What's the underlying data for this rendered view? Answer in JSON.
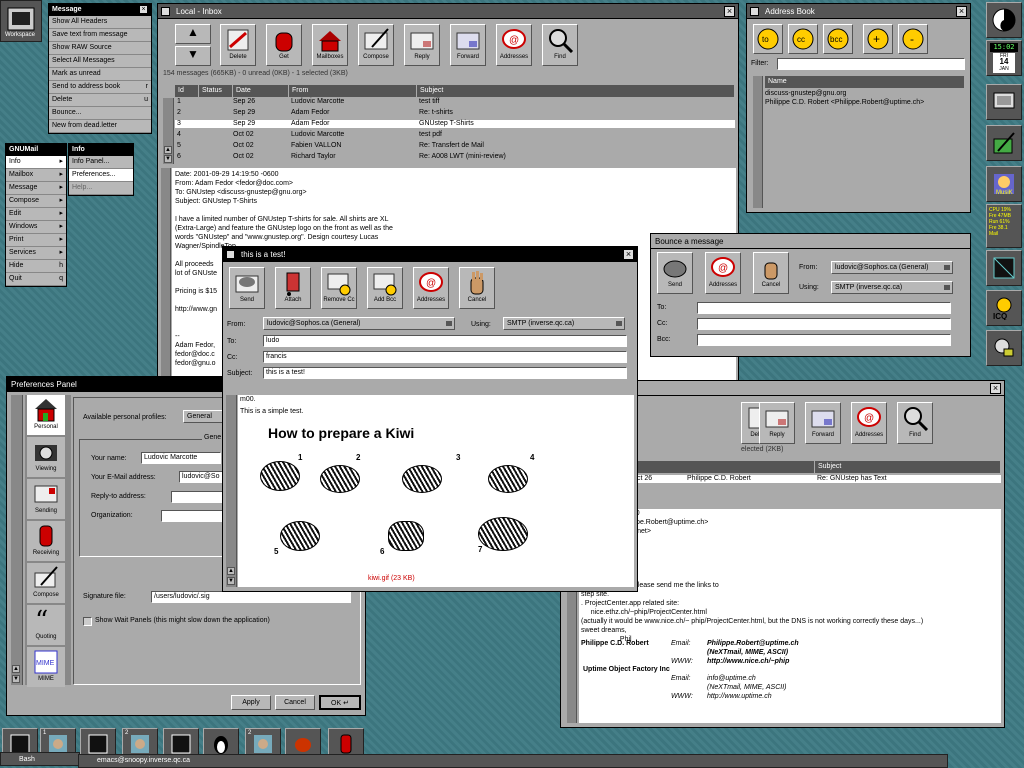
{
  "workspace": {
    "label": "Workspace"
  },
  "message_menu": {
    "title": "Message",
    "items": [
      "Show All Headers",
      "Save text from message",
      "Show RAW Source",
      "Select All Messages",
      "Mark as unread",
      "Send to address book",
      "Delete",
      "Bounce...",
      "New from dead.letter"
    ],
    "send_to_key": "r",
    "delete_key": "u"
  },
  "gnumail_menu": {
    "title": "GNUMail",
    "items": [
      "Info",
      "Mailbox",
      "Message",
      "Compose",
      "Edit",
      "Windows",
      "Print",
      "Services",
      "Hide",
      "Quit"
    ],
    "hide_key": "h",
    "quit_key": "q"
  },
  "info_menu": {
    "title": "Info",
    "items": [
      "Info Panel...",
      "Preferences...",
      "Help..."
    ]
  },
  "inbox": {
    "title": "Local - Inbox",
    "toolbar": [
      "Delete",
      "Get",
      "Mailboxes",
      "Compose",
      "Reply",
      "Forward",
      "Addresses",
      "Find"
    ],
    "status": "154 messages (665KB) - 0 unread (0KB) - 1 selected (3KB)",
    "columns": [
      "Id",
      "Status",
      "Date",
      "From",
      "Subject"
    ],
    "rows": [
      {
        "id": "1",
        "date": "Sep 26",
        "from": "Ludovic Marcotte",
        "subject": "test tiff"
      },
      {
        "id": "2",
        "date": "Sep 29",
        "from": "Adam Fedor",
        "subject": "Re: t-shirts"
      },
      {
        "id": "3",
        "date": "Sep 29",
        "from": "Adam Fedor",
        "subject": "GNUstep T-Shirts"
      },
      {
        "id": "4",
        "date": "Oct 02",
        "from": "Ludovic Marcotte",
        "subject": "test pdf"
      },
      {
        "id": "5",
        "date": "Oct 02",
        "from": "Fabien VALLON",
        "subject": "Re: Transfert de Mail"
      },
      {
        "id": "6",
        "date": "Oct 02",
        "from": "Richard Taylor",
        "subject": "Re: A008 LWT (mini-review)"
      }
    ],
    "body": "Date: 2001-09-29 14:19:50 -0600\nFrom: Adam Fedor <fedor@doc.com>\nTo: GNUstep <discuss-gnustep@gnu.org>\nSubject: GNUstep T-Shirts\n\nI have a limited number of GNUstep T-shirts for sale. All shirts are XL\n(Extra-Large) and feature the GNUstep logo on the front as well as the\nwords \"GNUstep\" and \"www.gnustep.org\". Design courtesy Lucas\nWagner/SpindleTop.\n\nAll proceeds\nlot of GNUste\n\nPricing is $15\n\nhttp://www.gn\n\n\n--\nAdam Fedor,\nfedor@doc.c\nfedor@gnu.o\n\n\nDiscuss-gnu"
  },
  "address_book": {
    "title": "Address Book",
    "buttons": [
      "to",
      "cc",
      "bcc",
      "+",
      "-"
    ],
    "filter_label": "Filter:",
    "column": "Name",
    "entries": [
      "discuss-gnustep@gnu.org",
      "Philippe C.D. Robert <Philippe.Robert@uptime.ch>"
    ]
  },
  "bounce": {
    "title": "Bounce a message",
    "toolbar": [
      "Send",
      "Addresses",
      "Cancel"
    ],
    "from_label": "From:",
    "from_value": "ludovic@Sophos.ca (General)",
    "using_label": "Using:",
    "using_value": "SMTP (inverse.qc.ca)",
    "to_label": "To:",
    "cc_label": "Cc:",
    "bcc_label": "Bcc:"
  },
  "compose": {
    "title": "this is a test!",
    "toolbar": [
      "Send",
      "Attach",
      "Remove Cc",
      "Add Bcc",
      "Addresses",
      "Cancel"
    ],
    "from_label": "From:",
    "from_value": "ludovic@Sophos.ca (General)",
    "using_label": "Using:",
    "using_value": "SMTP (inverse.qc.ca)",
    "to_label": "To:",
    "to_value": "ludo",
    "cc_label": "Cc:",
    "cc_value": "francis",
    "subject_label": "Subject:",
    "subject_value": "this is a test!",
    "body_line1": "m00.",
    "body_line2": "This is a simple test.",
    "heading": "How to prepare a Kiwi",
    "steps": [
      "1",
      "2",
      "3",
      "4",
      "5",
      "6",
      "7"
    ],
    "attachment": "kiwi.gif (23 KB)"
  },
  "mail2": {
    "toolbar": [
      "Delete",
      "Reply",
      "Forward",
      "Addresses",
      "Find"
    ],
    "status": "elected (2KB)",
    "subject_col": "Subject",
    "row_date": "ct 26",
    "row_from": "Philippe C.D. Robert",
    "row_subject": "Re: GNUstep has Text",
    "body": "26 09:04:22 +0100\n.D. Robert <Philippe.Robert@uptime.ch>\nensi@mindspring.net>\nstep@gnu.org\nUstep has Text\n\n\n\nting screenshots please send me the links to\nstep site.\n. ProjectCenter.app related site:\n     nice.ethz.ch/~phip/ProjectCenter.html\n(actually it would be www.nice.ch/~ phip/ProjectCenter.html, but the DNS is not working correctly these days...)\nsweet dreams,\n                    Phil",
    "sig_name": "Philippe C.D. Robert",
    "sig_email_label": "Email:",
    "sig_email": "Philippe.Robert@uptime.ch",
    "sig_mime": "(NeXTmail, MIME, ASCII)",
    "sig_www_label": "WWW:",
    "sig_www": "http://www.nice.ch/~phip",
    "sig_company": "Uptime Object Factory Inc",
    "sig_email2": "info@uptime.ch",
    "sig_mime2": "(NeXTmail, MIME, ASCII)",
    "sig_www2": "http://www.uptime.ch"
  },
  "prefs": {
    "title": "Preferences Panel",
    "sections": [
      "Personal",
      "Viewing",
      "Sending",
      "Receiving",
      "Compose",
      "Quoting",
      "MIME"
    ],
    "profiles_label": "Available personal profiles:",
    "profiles_value": "General",
    "group": "Gene",
    "name_label": "Your name:",
    "name_value": "Ludovic Marcotte",
    "email_label": "Your E-Mail address:",
    "email_value": "ludovic@So",
    "reply_label": "Reply-to address:",
    "org_label": "Organization:",
    "sig_label": "Signature file:",
    "sig_value": "/users/ludovic/.sig",
    "wait_label": "Show Wait Panels (this might slow down the application)",
    "apply": "Apply",
    "cancel": "Cancel",
    "ok": "OK"
  },
  "dock": {
    "clock_time": "15:02",
    "clock_day": "FRI",
    "clock_date": "14",
    "clock_month": "JAN",
    "cpu_text": "CPU 19%\nFre 47MB\nRun 61%\nFre 38.1\nMail"
  },
  "taskbar": {
    "bash": "Bash",
    "emacs": "emacs@snoopy.inverse.qc.ca",
    "nums": [
      "1",
      "2",
      "2"
    ]
  },
  "colors": {
    "desktop": "#3f7a82",
    "titlebar_active": "#000000",
    "titlebar_inactive": "#555555",
    "window": "#aaaaaa",
    "link_red": "#cc0000"
  }
}
